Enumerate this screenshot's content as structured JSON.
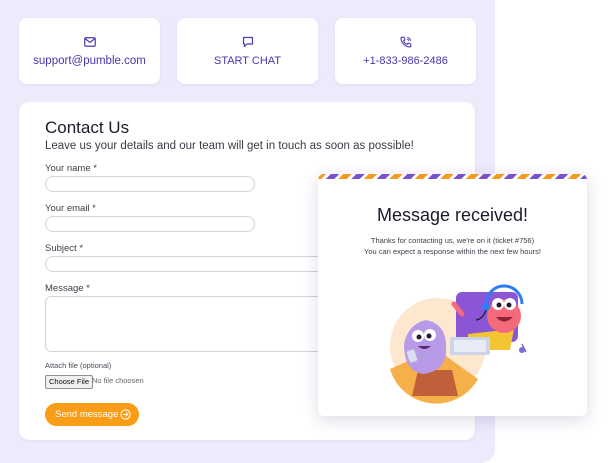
{
  "contacts": [
    {
      "icon": "envelope-icon",
      "label": "support@pumble.com"
    },
    {
      "icon": "chat-bubble-icon",
      "label": "START CHAT"
    },
    {
      "icon": "phone-icon",
      "label": "+1-833-986-2486"
    }
  ],
  "form": {
    "title": "Contact Us",
    "subtitle": "Leave us your details and our team will get in touch as soon as possible!",
    "name_label": "Your name *",
    "email_label": "Your email *",
    "subject_label": "Subject *",
    "message_label": "Message *",
    "attach_label": "Attach file (optional)",
    "choose_file_label": "Choose File",
    "no_file_text": "No file choosen",
    "send_label": "Send message"
  },
  "modal": {
    "title": "Message received!",
    "line1": "Thanks for contacting us, we're on it (ticket #756)",
    "line2": "You can expect a response within the next few hours!",
    "illustration": "support-mascots-illustration"
  },
  "colors": {
    "accent_purple": "#4b3bb0",
    "orange": "#f99d16",
    "panel_bg": "#ecebfb"
  }
}
